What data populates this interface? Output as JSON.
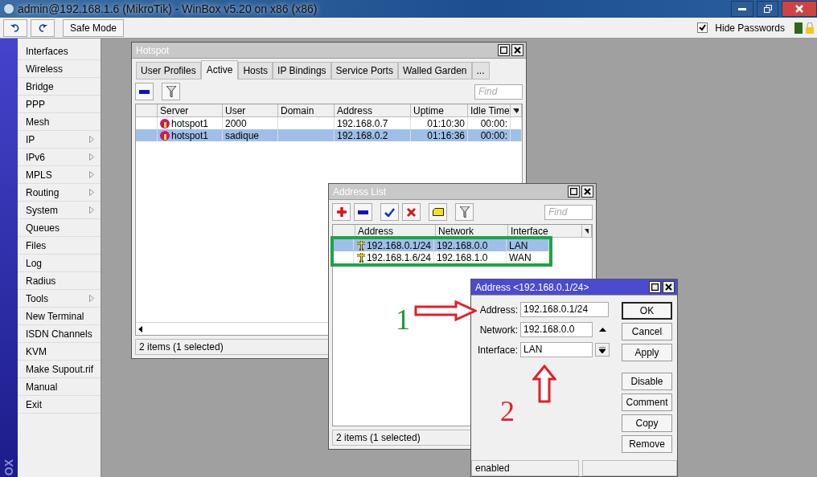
{
  "window": {
    "title": "admin@192.168.1.6 (MikroTik) - WinBox v5.20 on x86 (x86)"
  },
  "toolbar": {
    "safe_mode": "Safe Mode",
    "hide_passwords": {
      "label": "Hide Passwords",
      "checked": true
    }
  },
  "side_banner": "OX",
  "sidebar": {
    "items": [
      {
        "label": "Interfaces",
        "submenu": false
      },
      {
        "label": "Wireless",
        "submenu": false
      },
      {
        "label": "Bridge",
        "submenu": false
      },
      {
        "label": "PPP",
        "submenu": false
      },
      {
        "label": "Mesh",
        "submenu": false
      },
      {
        "label": "IP",
        "submenu": true
      },
      {
        "label": "IPv6",
        "submenu": true
      },
      {
        "label": "MPLS",
        "submenu": true
      },
      {
        "label": "Routing",
        "submenu": true
      },
      {
        "label": "System",
        "submenu": true
      },
      {
        "label": "Queues",
        "submenu": false
      },
      {
        "label": "Files",
        "submenu": false
      },
      {
        "label": "Log",
        "submenu": false
      },
      {
        "label": "Radius",
        "submenu": false
      },
      {
        "label": "Tools",
        "submenu": true
      },
      {
        "label": "New Terminal",
        "submenu": false
      },
      {
        "label": "ISDN Channels",
        "submenu": false
      },
      {
        "label": "KVM",
        "submenu": false
      },
      {
        "label": "Make Supout.rif",
        "submenu": false
      },
      {
        "label": "Manual",
        "submenu": false
      },
      {
        "label": "Exit",
        "submenu": false
      }
    ]
  },
  "hotspot": {
    "title": "Hotspot",
    "tabs": [
      {
        "label": "User Profiles",
        "selected": false
      },
      {
        "label": "Active",
        "selected": true
      },
      {
        "label": "Hosts",
        "selected": false
      },
      {
        "label": "IP Bindings",
        "selected": false
      },
      {
        "label": "Service Ports",
        "selected": false
      },
      {
        "label": "Walled Garden",
        "selected": false
      },
      {
        "label": "...",
        "selected": false
      }
    ],
    "find_placeholder": "Find",
    "columns": [
      "Server",
      "User",
      "Domain",
      "Address",
      "Uptime",
      "Idle Time"
    ],
    "rows": [
      {
        "server": "hotspot1",
        "user": "2000",
        "domain": "",
        "address": "192.168.0.7",
        "uptime": "01:10:30",
        "idle_time": "00:00:",
        "selected": false
      },
      {
        "server": "hotspot1",
        "user": "sadique",
        "domain": "",
        "address": "192.168.0.2",
        "uptime": "01:16:36",
        "idle_time": "00:00:",
        "selected": true
      }
    ],
    "status": "2 items (1 selected)"
  },
  "address_list": {
    "title": "Address List",
    "find_placeholder": "Find",
    "columns": [
      "Address",
      "Network",
      "Interface"
    ],
    "rows": [
      {
        "address": "192.168.0.1/24",
        "network": "192.168.0.0",
        "interface": "LAN",
        "selected": true
      },
      {
        "address": "192.168.1.6/24",
        "network": "192.168.1.0",
        "interface": "WAN",
        "selected": false
      }
    ],
    "status": "2 items (1 selected)"
  },
  "address_dialog": {
    "title": "Address <192.168.0.1/24>",
    "fields": [
      {
        "label": "Address:",
        "value": "192.168.0.1/24",
        "kind": "plain"
      },
      {
        "label": "Network:",
        "value": "192.168.0.0",
        "kind": "spin"
      },
      {
        "label": "Interface:",
        "value": "LAN",
        "kind": "dropdown"
      }
    ],
    "buttons": [
      {
        "label": "OK",
        "default": true
      },
      {
        "label": "Cancel",
        "default": false
      },
      {
        "label": "Apply",
        "default": false
      },
      {
        "label": "Disable",
        "default": false
      },
      {
        "label": "Comment",
        "default": false
      },
      {
        "label": "Copy",
        "default": false
      },
      {
        "label": "Remove",
        "default": false
      }
    ],
    "status": "enabled"
  },
  "annotations": [
    {
      "text": "1",
      "color": "#1a9a3a"
    },
    {
      "text": "2",
      "color": "#e0202a"
    }
  ]
}
